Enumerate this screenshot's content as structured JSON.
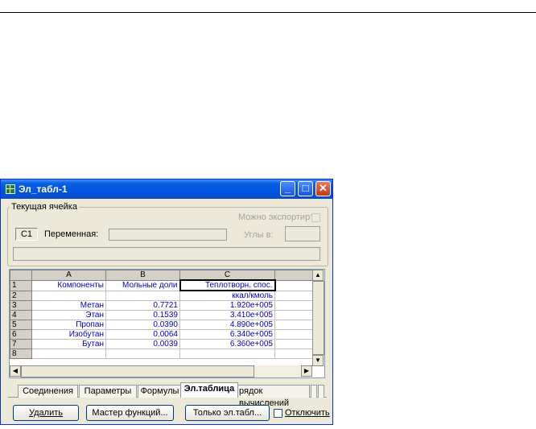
{
  "window": {
    "title": "Эл_табл-1",
    "controls": {
      "minimize": "_",
      "maximize": "□",
      "close": "✕"
    }
  },
  "current_cell": {
    "legend": "Текущая ячейка",
    "cell_ref": "C1",
    "variable_label": "Переменная:",
    "variable_value": "",
    "exportable_label": "Можно экспортир?",
    "exportable_checked": false,
    "angles_label": "Углы в:",
    "angles_value": "",
    "formula_value": ""
  },
  "spreadsheet": {
    "columns": [
      "A",
      "B",
      "C"
    ],
    "rows": [
      {
        "num": "1",
        "cells": [
          "Компоненты",
          "Мольные доли",
          "Теплотворн. спос."
        ]
      },
      {
        "num": "2",
        "cells": [
          "",
          "",
          "ккал/кмоль"
        ]
      },
      {
        "num": "3",
        "cells": [
          "Метан",
          "0.7721",
          "1.920e+005"
        ]
      },
      {
        "num": "4",
        "cells": [
          "Этан",
          "0.1539",
          "3.410e+005"
        ]
      },
      {
        "num": "5",
        "cells": [
          "Пропан",
          "0.0390",
          "4.890e+005"
        ]
      },
      {
        "num": "6",
        "cells": [
          "Изобутан",
          "0.0064",
          "6.340e+005"
        ]
      },
      {
        "num": "7",
        "cells": [
          "Бутан",
          "0.0039",
          "6.360e+005"
        ]
      },
      {
        "num": "8",
        "cells": [
          "",
          "",
          ""
        ]
      }
    ],
    "selected_cell": "C1"
  },
  "tabs": [
    "Соединения",
    "Параметры",
    "Формулы",
    "Эл.таблица",
    "рядок вычислений"
  ],
  "active_tab": "Эл.таблица",
  "buttons": {
    "delete": "Удалить",
    "function_wizard": "Мастер функций...",
    "sheet_only": "Только эл.табл...",
    "disable_label": "Отключить",
    "disable_checked": false
  },
  "colors": {
    "title_bar": "#0054e3",
    "cell_text": "#0000cc",
    "window_bg": "#ece9d8"
  }
}
